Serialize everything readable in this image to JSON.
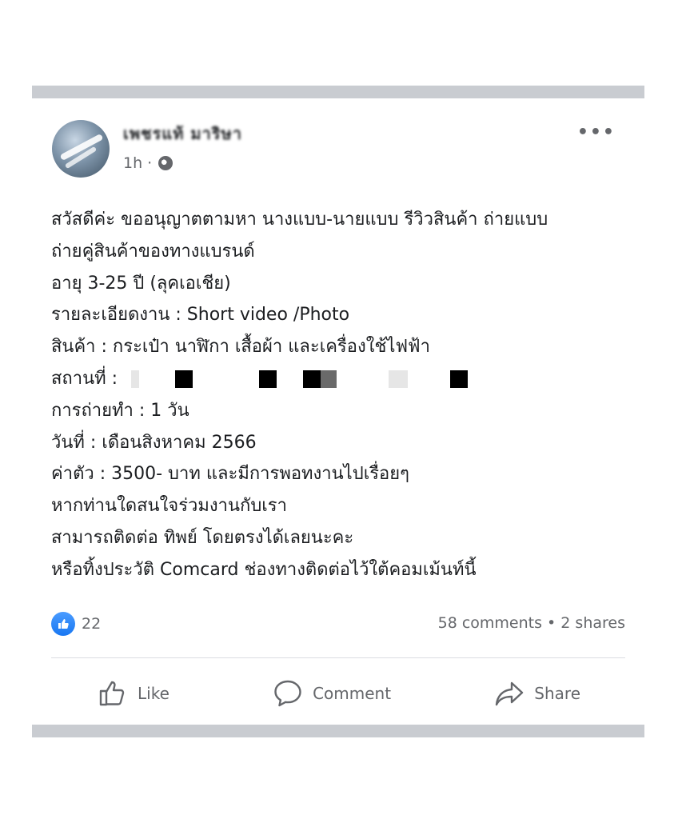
{
  "post": {
    "author": "เพชรแท้ มาริษา",
    "time": "1h ·",
    "more_icon": "more-options-icon",
    "lines": [
      "สวัสดีค่ะ ขออนุญาตตามหา นางแบบ-นายแบบ รีวิวสินค้า ถ่ายแบบ",
      "ถ่ายคู่สินค้าของทางแบรนด์",
      "อายุ 3-25 ปี (ลุคเอเชีย)",
      "รายละเอียดงาน : Short video /Photo",
      "สินค้า : กระเป๋า นาฬิกา เสื้อผ้า และเครื่องใช้ไฟฟ้า",
      "สถานที่ :",
      "การถ่ายทำ : 1 วัน",
      "วันที่ : เดือนสิงหาคม 2566",
      "ค่าตัว : 3500- บาท และมีการพอทงานไปเรื่อยๆ",
      "หากท่านใดสนใจร่วมงานกับเรา",
      "สามารถติดต่อ ทิพย์ โดยตรงได้เลยนะคะ",
      "หรือทิ้งประวัติ Comcard ช่องทางติดต่อไว้ใต้คอมเม้นท์นี้"
    ]
  },
  "reactions": {
    "count": "22",
    "stats": "58 comments • 2 shares"
  },
  "actions": {
    "like": "Like",
    "comment": "Comment",
    "share": "Share"
  },
  "colors": {
    "accent": "#1877f2",
    "muted": "#65676b",
    "separator": "#c9ccd1"
  }
}
